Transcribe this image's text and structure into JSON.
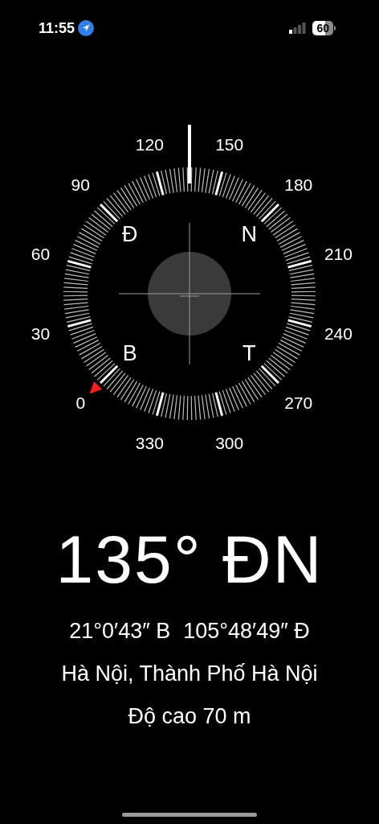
{
  "status_bar": {
    "time": "11:55",
    "battery": "60"
  },
  "compass": {
    "dial_labels": [
      "0",
      "30",
      "60",
      "90",
      "120",
      "150",
      "180",
      "210",
      "240",
      "270",
      "300",
      "330"
    ],
    "cardinals": [
      "Đ",
      "N",
      "B",
      "T"
    ]
  },
  "heading": "135° ĐN",
  "coordinates": {
    "latitude": "21°0′43″ B",
    "longitude": "105°48′49″ Đ"
  },
  "location": "Hà Nội, Thành Phố Hà Nội",
  "altitude": "Độ cao 70 m"
}
